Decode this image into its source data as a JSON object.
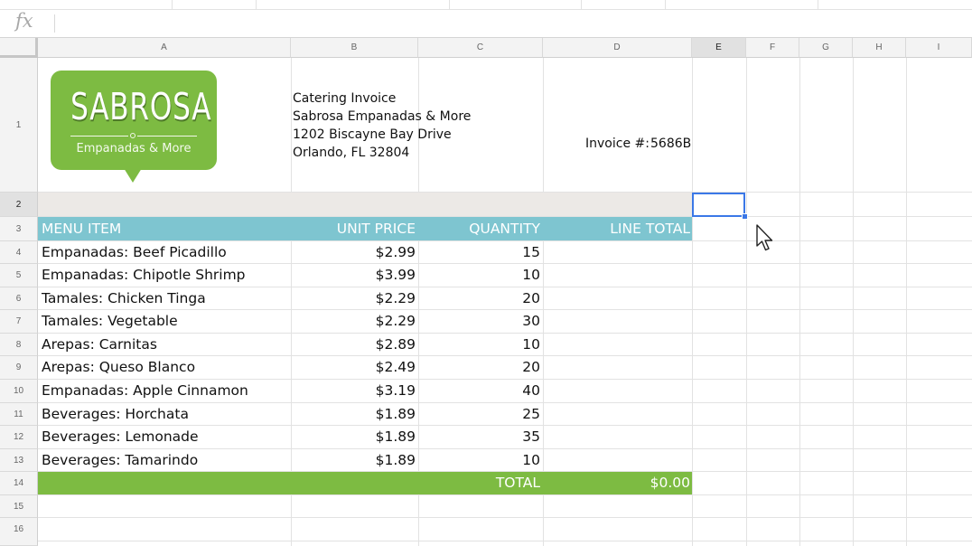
{
  "formula_bar": {
    "fx_label": "fx",
    "value": ""
  },
  "columns": [
    "A",
    "B",
    "C",
    "D",
    "E",
    "F",
    "G",
    "H",
    "I"
  ],
  "rows": [
    "1",
    "2",
    "3",
    "4",
    "5",
    "6",
    "7",
    "8",
    "9",
    "10",
    "11",
    "12",
    "13",
    "14",
    "15",
    "16"
  ],
  "logo": {
    "title": "SABROSA",
    "subtitle": "Empanadas & More",
    "color": "#7dbb42"
  },
  "header_info": {
    "lines": [
      "Catering Invoice",
      "Sabrosa Empanadas & More",
      "1202 Biscayne Bay Drive",
      "Orlando, FL 32804"
    ],
    "invoice_label": "Invoice #:",
    "invoice_number": "5686B"
  },
  "table": {
    "headers": [
      "MENU ITEM",
      "UNIT PRICE",
      "QUANTITY",
      "LINE TOTAL"
    ],
    "header_color": "#7ec5d0",
    "items": [
      {
        "name": "Empanadas: Beef Picadillo",
        "price": "$2.99",
        "qty": "15"
      },
      {
        "name": "Empanadas: Chipotle Shrimp",
        "price": "$3.99",
        "qty": "10"
      },
      {
        "name": "Tamales: Chicken Tinga",
        "price": "$2.29",
        "qty": "20"
      },
      {
        "name": "Tamales: Vegetable",
        "price": "$2.29",
        "qty": "30"
      },
      {
        "name": "Arepas: Carnitas",
        "price": "$2.89",
        "qty": "10"
      },
      {
        "name": "Arepas: Queso Blanco",
        "price": "$2.49",
        "qty": "20"
      },
      {
        "name": "Empanadas: Apple Cinnamon",
        "price": "$3.19",
        "qty": "40"
      },
      {
        "name": "Beverages: Horchata",
        "price": "$1.89",
        "qty": "25"
      },
      {
        "name": "Beverages: Lemonade",
        "price": "$1.89",
        "qty": "35"
      },
      {
        "name": "Beverages: Tamarindo",
        "price": "$1.89",
        "qty": "10"
      }
    ],
    "total_label": "TOTAL",
    "total_value": "$0.00",
    "total_color": "#7dbb42",
    "spacer_color": "#ece9e6"
  },
  "selection": {
    "cell": "E2"
  },
  "cursor": "arrow-cursor-icon"
}
